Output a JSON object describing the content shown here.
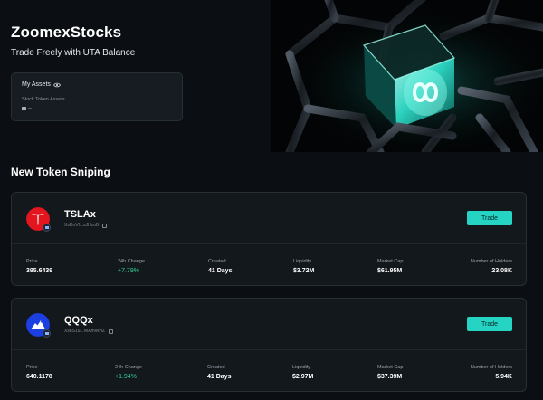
{
  "hero": {
    "title": "ZoomexStocks",
    "subtitle": "Trade Freely with UTA Balance",
    "assets_card": {
      "heading": "My Assets",
      "eye_icon": "eye-icon",
      "label": "Stock Token Assets",
      "value": "--"
    }
  },
  "section": {
    "title": "New Token Sniping"
  },
  "tokens": [
    {
      "name": "TSLAx",
      "address": "XsDoVf...sJHzoB",
      "logo_icon": "tesla-logo-icon",
      "logo_color": "#e3151e",
      "trade_label": "Trade",
      "stats": {
        "price": {
          "label": "Price",
          "value": "395.6439"
        },
        "change": {
          "label": "24h Change",
          "value": "+7.79%"
        },
        "created": {
          "label": "Created",
          "value": "41 Days"
        },
        "liquidity": {
          "label": "Liquidity",
          "value": "$3.72M"
        },
        "market_cap": {
          "label": "Market Cap",
          "value": "$61.95M"
        },
        "holders": {
          "label": "Number of Holders",
          "value": "23.08K"
        }
      }
    },
    {
      "name": "QQQx",
      "address": "Xs8S1u...WAmWHZ",
      "logo_icon": "qqq-logo-icon",
      "logo_color": "#1b3fe0",
      "trade_label": "Trade",
      "stats": {
        "price": {
          "label": "Price",
          "value": "640.1178"
        },
        "change": {
          "label": "24h Change",
          "value": "+1.94%"
        },
        "created": {
          "label": "Created",
          "value": "41 Days"
        },
        "liquidity": {
          "label": "Liquidity",
          "value": "$2.97M"
        },
        "market_cap": {
          "label": "Market Cap",
          "value": "$37.39M"
        },
        "holders": {
          "label": "Number of Holders",
          "value": "5.94K"
        }
      }
    }
  ],
  "colors": {
    "background": "#0b0f13",
    "card": "#13181d",
    "accent": "#26d4c4",
    "positive": "#2fcf95"
  }
}
